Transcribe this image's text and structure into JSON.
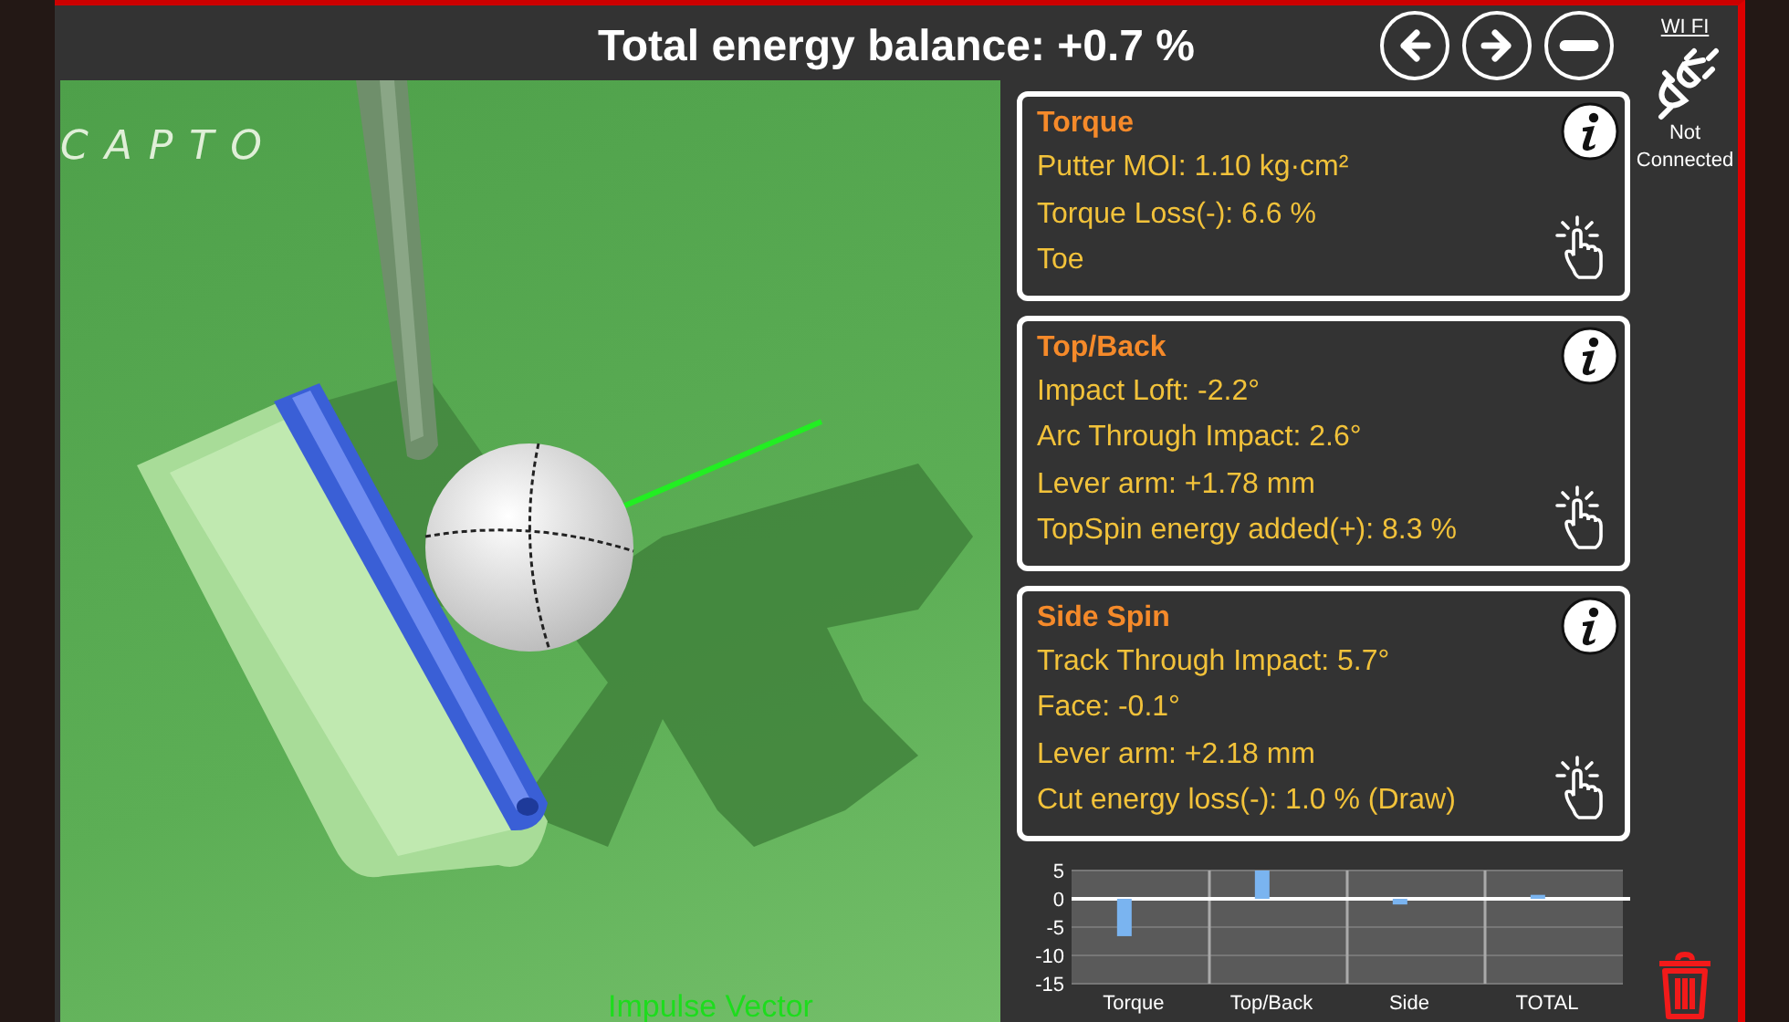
{
  "header": {
    "title": "Total energy balance: +0.7 %",
    "buttons": [
      {
        "kind": "back"
      },
      {
        "kind": "forward"
      },
      {
        "kind": "minus"
      }
    ]
  },
  "scene": {
    "logo": "CAPTO",
    "caption": "Impulse Vector"
  },
  "panels": [
    {
      "title": "Torque",
      "lines": [
        "Putter MOI: 1.10 kg·cm²",
        "Torque Loss(-): 6.6 %",
        "Toe"
      ]
    },
    {
      "title": "Top/Back",
      "lines": [
        "Impact Loft: -2.2°",
        "Arc Through Impact: 2.6°",
        "Lever arm: +1.78 mm",
        "TopSpin energy added(+): 8.3 %"
      ]
    },
    {
      "title": "Side Spin",
      "lines": [
        "Track Through Impact: 5.7°",
        "Face: -0.1°",
        "Lever arm: +2.18 mm",
        "Cut energy loss(-): 1.0 % (Draw)"
      ]
    }
  ],
  "connection": {
    "label": "WI FI",
    "status": "Not Connected"
  },
  "energy_chart": {
    "chart_data": {
      "type": "bar",
      "categories": [
        "Torque",
        "Top/Back",
        "Side",
        "TOTAL"
      ],
      "series": [
        {
          "color": "#7ab4f0",
          "values": [
            -6.6,
            5,
            -1.0,
            0.7
          ]
        }
      ],
      "ylim": [
        -15,
        5
      ],
      "yticks": [
        5,
        0,
        -5,
        -10,
        -15
      ]
    }
  }
}
